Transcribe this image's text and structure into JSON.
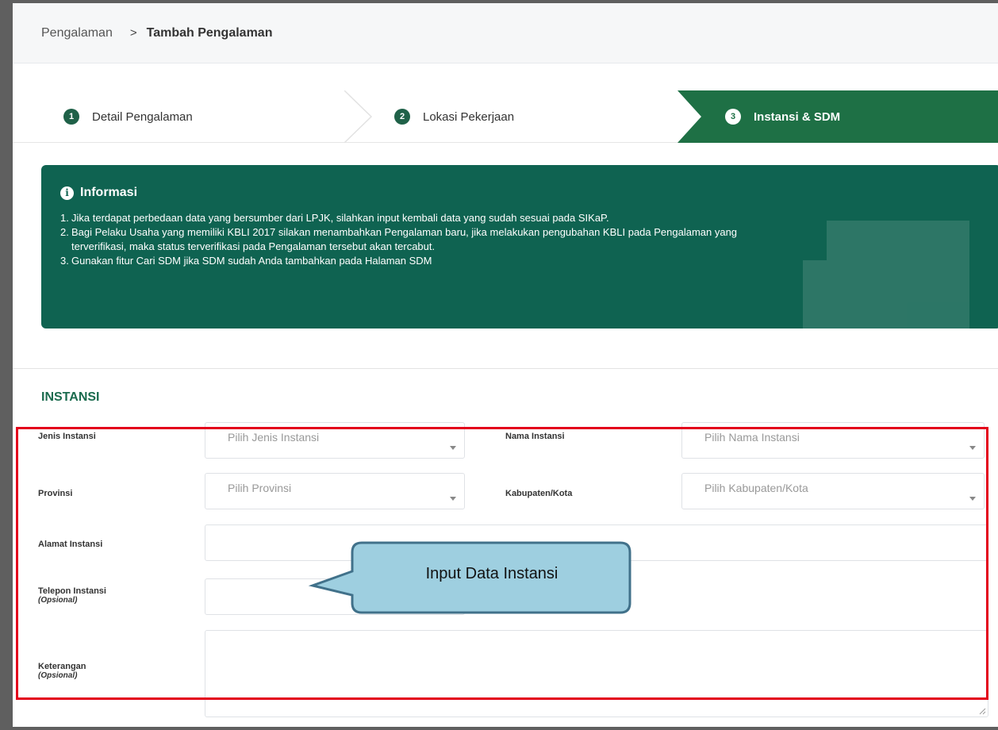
{
  "breadcrumb": {
    "parent": "Pengalaman",
    "separator": ">",
    "current": "Tambah Pengalaman"
  },
  "steps": [
    {
      "number": "1",
      "label": "Detail Pengalaman",
      "active": false
    },
    {
      "number": "2",
      "label": "Lokasi Pekerjaan",
      "active": false
    },
    {
      "number": "3",
      "label": "Instansi & SDM",
      "active": true
    }
  ],
  "info": {
    "icon": "info-circle-icon",
    "title": "Informasi",
    "items": [
      {
        "num": "1.",
        "text": "Jika terdapat perbedaan data yang bersumber dari LPJK, silahkan input kembali data yang sudah sesuai pada SIKaP.",
        "cont": ""
      },
      {
        "num": "2.",
        "text": "Bagi Pelaku Usaha yang memiliki KBLI 2017 silakan menambahkan Pengalaman baru, jika melakukan pengubahan KBLI pada Pengalaman yang",
        "cont": "terverifikasi, maka status terverifikasi pada Pengalaman tersebut akan tercabut."
      },
      {
        "num": "3.",
        "text": "Gunakan fitur Cari SDM jika SDM sudah Anda tambahkan pada Halaman SDM",
        "cont": ""
      }
    ]
  },
  "section": {
    "title": "INSTANSI"
  },
  "form": {
    "jenis_instansi": {
      "label": "Jenis Instansi",
      "placeholder": "Pilih Jenis Instansi"
    },
    "nama_instansi": {
      "label": "Nama Instansi",
      "placeholder": "Pilih Nama Instansi"
    },
    "provinsi": {
      "label": "Provinsi",
      "placeholder": "Pilih Provinsi"
    },
    "kabupaten": {
      "label": "Kabupaten/Kota",
      "placeholder": "Pilih Kabupaten/Kota"
    },
    "alamat": {
      "label": "Alamat Instansi",
      "value": ""
    },
    "telepon": {
      "label": "Telepon Instansi",
      "optional": "(Opsional)",
      "value": ""
    },
    "keterangan": {
      "label": "Keterangan",
      "optional": "(Opsional)",
      "value": ""
    }
  },
  "callout": {
    "text": "Input Data Instansi"
  },
  "colors": {
    "primary_green": "#1e7045",
    "info_bg": "#0f6351",
    "section_title": "#1b6b4e",
    "highlight_red": "#e3001b",
    "callout_fill": "#9ecfe0",
    "callout_border": "#41718a"
  }
}
